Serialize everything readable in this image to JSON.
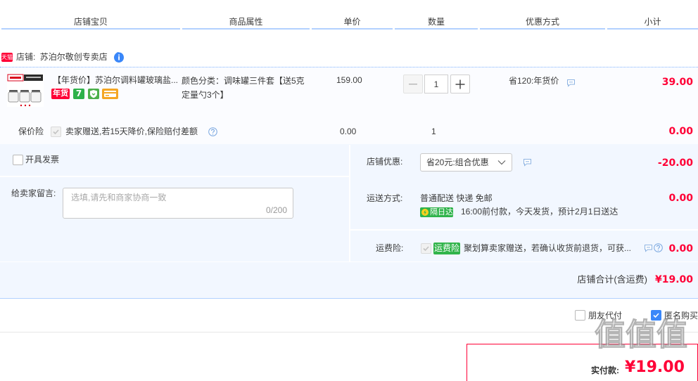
{
  "header": {
    "columns": [
      "店铺宝贝",
      "商品属性",
      "单价",
      "数量",
      "优惠方式",
      "小计"
    ]
  },
  "shop": {
    "badge": "天猫",
    "label": "店铺:",
    "name": "苏泊尔敬创专卖店",
    "info_icon": "info-drop-icon"
  },
  "item": {
    "title": "【年货价】苏泊尔调料罐玻璃盐...",
    "badges": [
      {
        "text": "年货",
        "icon": "new-year-badge"
      },
      {
        "text": "7",
        "icon": "seven-day-return-badge"
      },
      {
        "icon": "shield-icon"
      },
      {
        "icon": "credit-card-icon"
      }
    ],
    "sku": "颜色分类：调味罐三件套【送5克定量勺3个】",
    "price": "159.00",
    "quantity": "1",
    "promo": "省120:年货价",
    "subtotal": "39.00"
  },
  "price_insurance": {
    "label": "保价险",
    "checked": true,
    "desc": "卖家赠送,若15天降价,保险赔付差额",
    "price": "0.00",
    "quantity": "1",
    "subtotal": "0.00"
  },
  "invoice": {
    "label": "开具发票",
    "checked": false
  },
  "message": {
    "label": "给卖家留言:",
    "placeholder": "选填,请先和商家协商一致",
    "counter": "0/200"
  },
  "shop_discount": {
    "label": "店铺优惠:",
    "selected": "省20元:组合优惠",
    "amount": "-20.00"
  },
  "shipping": {
    "label": "运送方式:",
    "method": "普通配送 快递 免邮",
    "badge": "隔日达",
    "note": "16:00前付款，今天发货，预计2月1日送达",
    "amount": "0.00"
  },
  "freight_insurance": {
    "label": "运费险:",
    "checked": true,
    "badge": "运费险",
    "desc": "聚划算卖家赠送，若确认收货前退货，可获...",
    "amount": "0.00"
  },
  "shop_total": {
    "label": "店铺合计(含运费)",
    "amount": "¥19.00"
  },
  "options": {
    "friend_pay": {
      "label": "朋友代付",
      "checked": false
    },
    "anonymous": {
      "label": "匿名购买",
      "checked": true
    }
  },
  "payment": {
    "label": "实付款:",
    "amount": "¥19.00"
  },
  "watermark": "值值值",
  "colors": {
    "price_red": "#ff0036",
    "border_blue": "#b2d1ff",
    "panel_bg": "#f2f7ff",
    "item_bg": "#fbfcff",
    "badge_green": "#31b44a",
    "checkbox_blue": "#3a87f9"
  }
}
